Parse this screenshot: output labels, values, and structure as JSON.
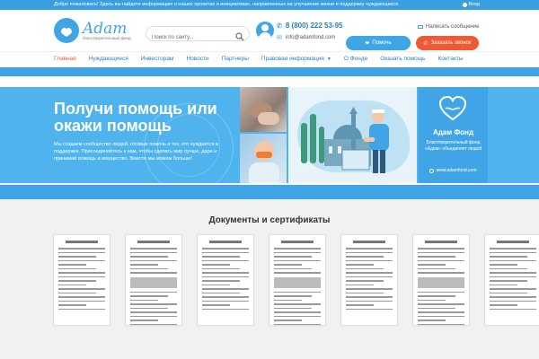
{
  "topbar": {
    "welcome": "Добро пожаловать! Здесь вы найдете информацию о наших проектах и инициативах, направленных на улучшение жизни и поддержку нуждающихся.",
    "login": "Вход"
  },
  "header": {
    "logo_brand": "Adam",
    "logo_sub": "благотворительный фонд",
    "search_placeholder": "Поиск по сайту...",
    "phone": "8 (800) 222 53-95",
    "email": "info@adamfond.com",
    "write_message": "Написать сообщение",
    "help_button": "Помочь",
    "call_button": "Заказать звонок"
  },
  "nav": {
    "items": [
      {
        "label": "Главная",
        "active": true
      },
      {
        "label": "Нуждающиеся"
      },
      {
        "label": "Инвесторам"
      },
      {
        "label": "Новости"
      },
      {
        "label": "Партнеры"
      },
      {
        "label": "Правовая информация"
      },
      {
        "label": "О Фонде"
      },
      {
        "label": "Оказать помощь"
      },
      {
        "label": "Контакты"
      }
    ]
  },
  "banner": {
    "headline": "Получи помощь или окажи помощь",
    "description": "Мы создаем сообщество людей, готовых помочь и тех, кто нуждается в поддержке. Присоединяйтесь к нам, чтобы сделать мир лучше, дари и принимай помощь и имущество. Вместе мы можем больше!",
    "fund_title": "Адам Фонд",
    "fund_text": "Благотворительный фонд «Адам» объединяет людей",
    "fund_site": "www.adamfond.com"
  },
  "documents": {
    "title": "Документы и сертификаты",
    "count": 7
  },
  "colors": {
    "primary": "#3fa5e6",
    "accent": "#ef5a35",
    "topbar": "#3a9fe0"
  }
}
